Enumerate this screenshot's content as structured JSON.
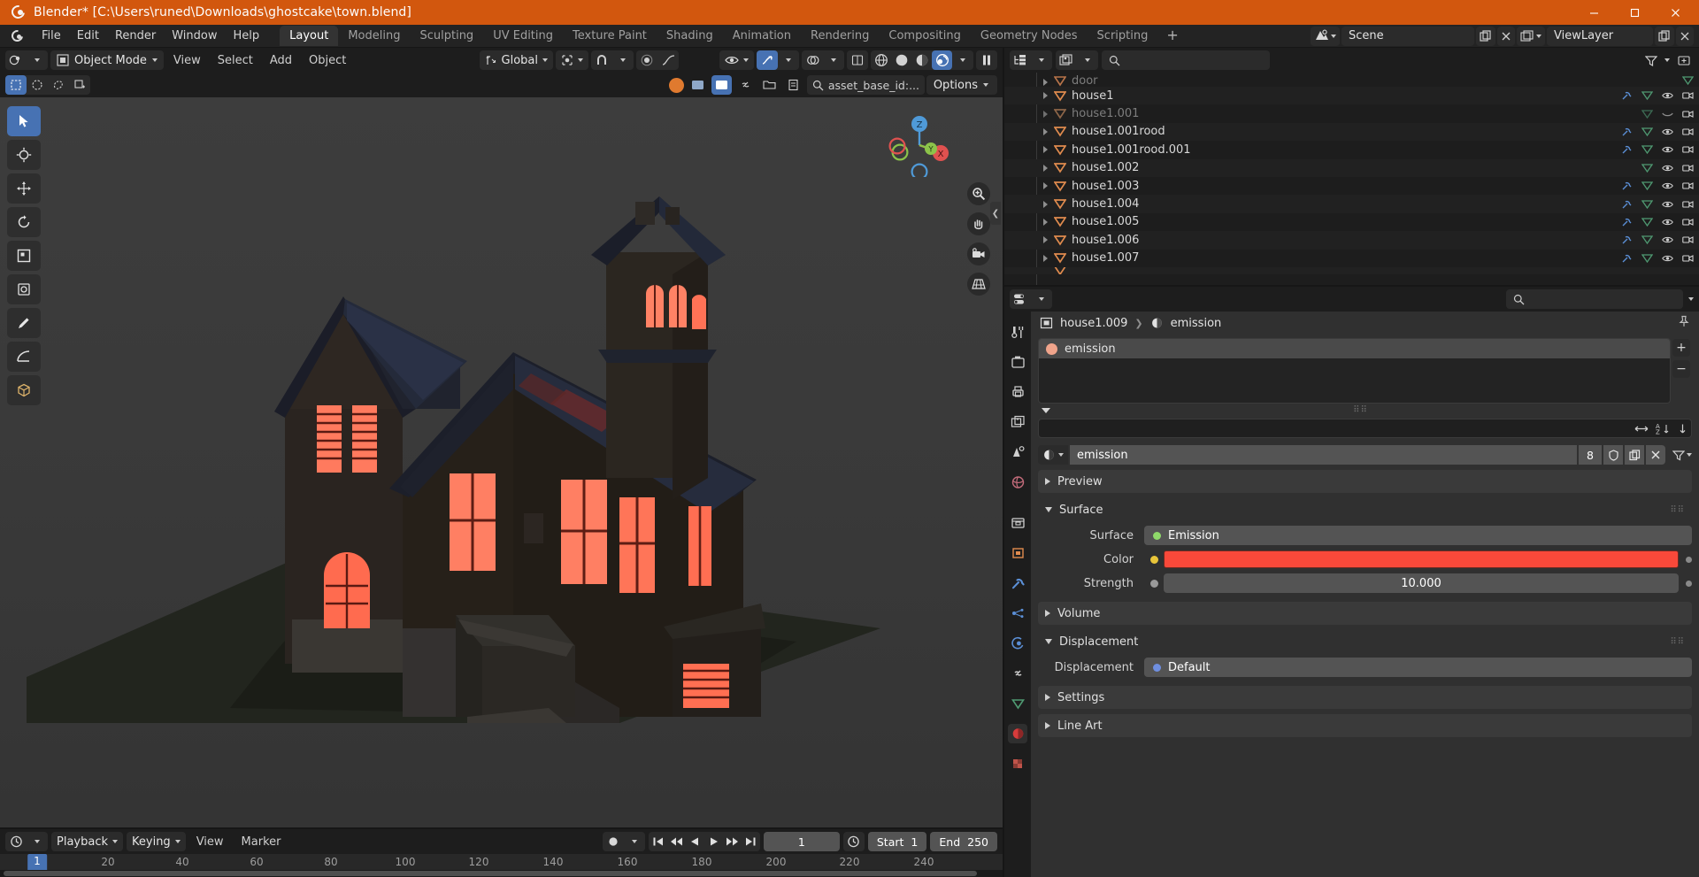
{
  "titlebar": {
    "title": "Blender* [C:\\Users\\runed\\Downloads\\ghostcake\\town.blend]",
    "logo_icon": "blender-logo-icon",
    "minimize": "—",
    "maximize": "☐",
    "close": "✕"
  },
  "menubar": {
    "items": [
      "File",
      "Edit",
      "Render",
      "Window",
      "Help"
    ],
    "tabs": [
      {
        "label": "Layout",
        "active": true
      },
      {
        "label": "Modeling",
        "active": false
      },
      {
        "label": "Sculpting",
        "active": false
      },
      {
        "label": "UV Editing",
        "active": false
      },
      {
        "label": "Texture Paint",
        "active": false
      },
      {
        "label": "Shading",
        "active": false
      },
      {
        "label": "Animation",
        "active": false
      },
      {
        "label": "Rendering",
        "active": false
      },
      {
        "label": "Compositing",
        "active": false
      },
      {
        "label": "Geometry Nodes",
        "active": false
      },
      {
        "label": "Scripting",
        "active": false
      }
    ],
    "add_tab": "+",
    "scene_name": "Scene",
    "view_layer_name": "ViewLayer"
  },
  "viewport_header": {
    "mode": "Object Mode",
    "menus": [
      "View",
      "Select",
      "Add",
      "Object"
    ],
    "transform_orientation": "Global",
    "options_label": "Options",
    "search_value": "asset_base_id:...",
    "shading_modes": [
      "wireframe",
      "solid",
      "material-preview",
      "rendered"
    ],
    "active_shading": "rendered"
  },
  "viewport": {
    "gizmo_axes": [
      "Z",
      "Y",
      "X"
    ],
    "tools": [
      "tweak-tool",
      "cursor-tool",
      "move-tool",
      "rotate-tool",
      "scale-tool",
      "transform-tool",
      "annotate-tool",
      "measure-tool",
      "add-cube-tool"
    ],
    "active_tool": "tweak-tool",
    "nav_icons": [
      "zoom-icon",
      "pan-icon",
      "camera-icon",
      "grid-icon"
    ]
  },
  "outliner": {
    "display_mode_icon": "outliner-icon",
    "filter_icon": "filter-icon",
    "search_placeholder": "",
    "rows": [
      {
        "name": "door",
        "dim": true,
        "partial": true
      },
      {
        "name": "house1",
        "dim": false
      },
      {
        "name": "house1.001",
        "dim": true
      },
      {
        "name": "house1.001rood",
        "dim": false
      },
      {
        "name": "house1.001rood.001",
        "dim": false
      },
      {
        "name": "house1.002",
        "dim": false
      },
      {
        "name": "house1.003",
        "dim": false
      },
      {
        "name": "house1.004",
        "dim": false
      },
      {
        "name": "house1.005",
        "dim": false
      },
      {
        "name": "house1.006",
        "dim": false
      },
      {
        "name": "house1.007",
        "dim": false
      }
    ]
  },
  "properties": {
    "editor_icon": "properties-editor-icon",
    "breadcrumb": {
      "object_icon": "object-icon",
      "object": "house1.009",
      "separator": "❯",
      "material_icon": "material-icon",
      "material": "emission"
    },
    "material_slots": [
      {
        "name": "emission",
        "selected": true,
        "color": "#f0a48b"
      }
    ],
    "slot_buttons": {
      "add": "+",
      "remove": "−"
    },
    "sort_icons": [
      "sort-alpha-icon",
      "sort-desc-icon",
      "link-icon"
    ],
    "material_id": {
      "browse_icon": "material-browse-icon",
      "name": "emission",
      "users": "8",
      "fake_user_icon": "shield-icon",
      "new_copy_icon": "copy-icon",
      "unlink_icon": "x-icon",
      "specials_icon": "dropdown-icon"
    },
    "panels": [
      {
        "label": "Preview",
        "open": false
      },
      {
        "label": "Surface",
        "open": true
      },
      {
        "label": "Volume",
        "open": false
      },
      {
        "label": "Displacement",
        "open": true
      },
      {
        "label": "Settings",
        "open": false
      },
      {
        "label": "Line Art",
        "open": false
      }
    ],
    "surface": {
      "surface_label": "Surface",
      "surface_value": "Emission",
      "surface_socket_color": "#8fd96a",
      "color_label": "Color",
      "color_value": "#f9493a",
      "color_socket_color": "#e8c53a",
      "strength_label": "Strength",
      "strength_value": "10.000",
      "strength_socket_color": "#999999"
    },
    "displacement": {
      "label": "Displacement",
      "value": "Default",
      "socket_color": "#6f8fe0"
    }
  },
  "timeline": {
    "editor_icon": "timeline-icon",
    "menus": [
      "Playback",
      "Keying",
      "View",
      "Marker"
    ],
    "record_icon": "record-icon",
    "transport": [
      "jump-start",
      "prev-keyframe",
      "play-reverse",
      "play",
      "next-keyframe",
      "jump-end"
    ],
    "current_frame": "1",
    "auto_key_icon": "clock-icon",
    "start_label": "Start",
    "start_value": "1",
    "end_label": "End",
    "end_value": "250",
    "ticks": [
      {
        "label": "1",
        "pos": 1
      },
      {
        "label": "20",
        "pos": 20
      },
      {
        "label": "40",
        "pos": 40
      },
      {
        "label": "60",
        "pos": 60
      },
      {
        "label": "80",
        "pos": 80
      },
      {
        "label": "100",
        "pos": 100
      },
      {
        "label": "120",
        "pos": 120
      },
      {
        "label": "140",
        "pos": 140
      },
      {
        "label": "160",
        "pos": 160
      },
      {
        "label": "180",
        "pos": 180
      },
      {
        "label": "200",
        "pos": 200
      },
      {
        "label": "220",
        "pos": 220
      },
      {
        "label": "240",
        "pos": 240
      }
    ]
  },
  "colors": {
    "accent_orange": "#d2570e",
    "accent_blue": "#4772b3",
    "emission_red": "#f9493a",
    "window_bg": "#1d1d1d",
    "panel_bg": "#303030"
  }
}
